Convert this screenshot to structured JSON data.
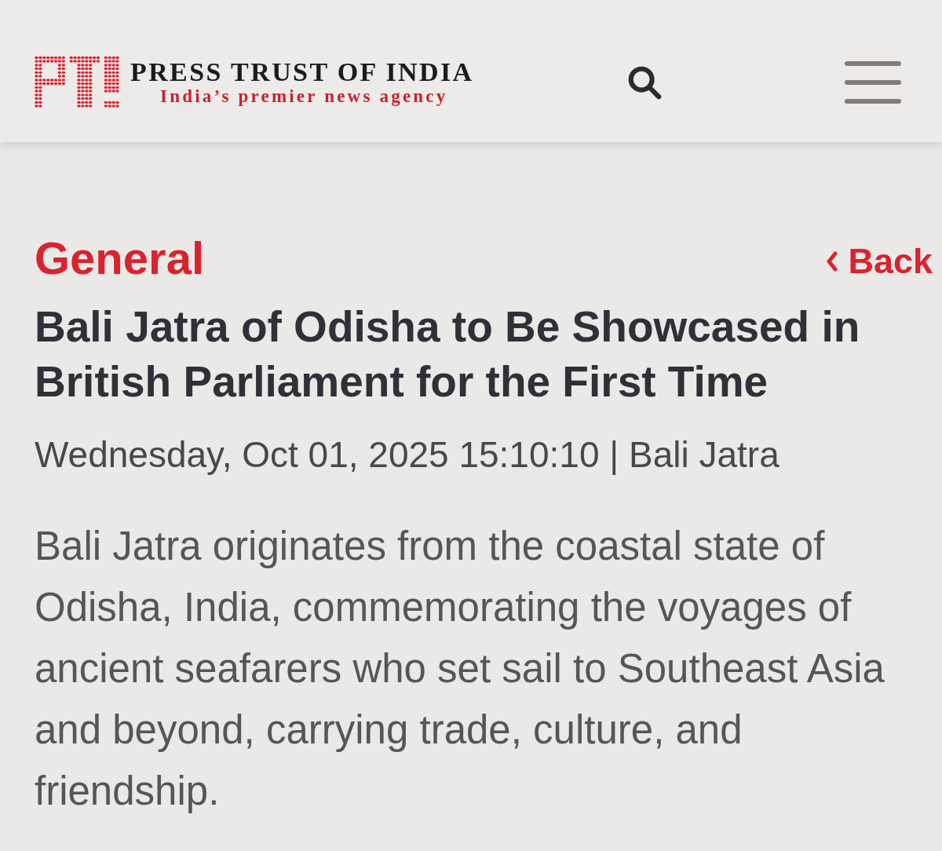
{
  "header": {
    "brand": "PRESS TRUST OF INDIA",
    "tagline": "India’s premier news agency"
  },
  "article": {
    "category": "General",
    "back": {
      "label": "Back"
    },
    "headline": "Bali Jatra of Odisha to Be Showcased in British Parliament for the First Time",
    "meta": "Wednesday, Oct 01, 2025 15:10:10 | Bali Jatra",
    "body": "Bali Jatra originates from the coastal state of Odisha, India, commemorating the voyages of ancient seafarers who set sail to Southeast Asia and beyond, carrying trade, culture, and friendship."
  }
}
